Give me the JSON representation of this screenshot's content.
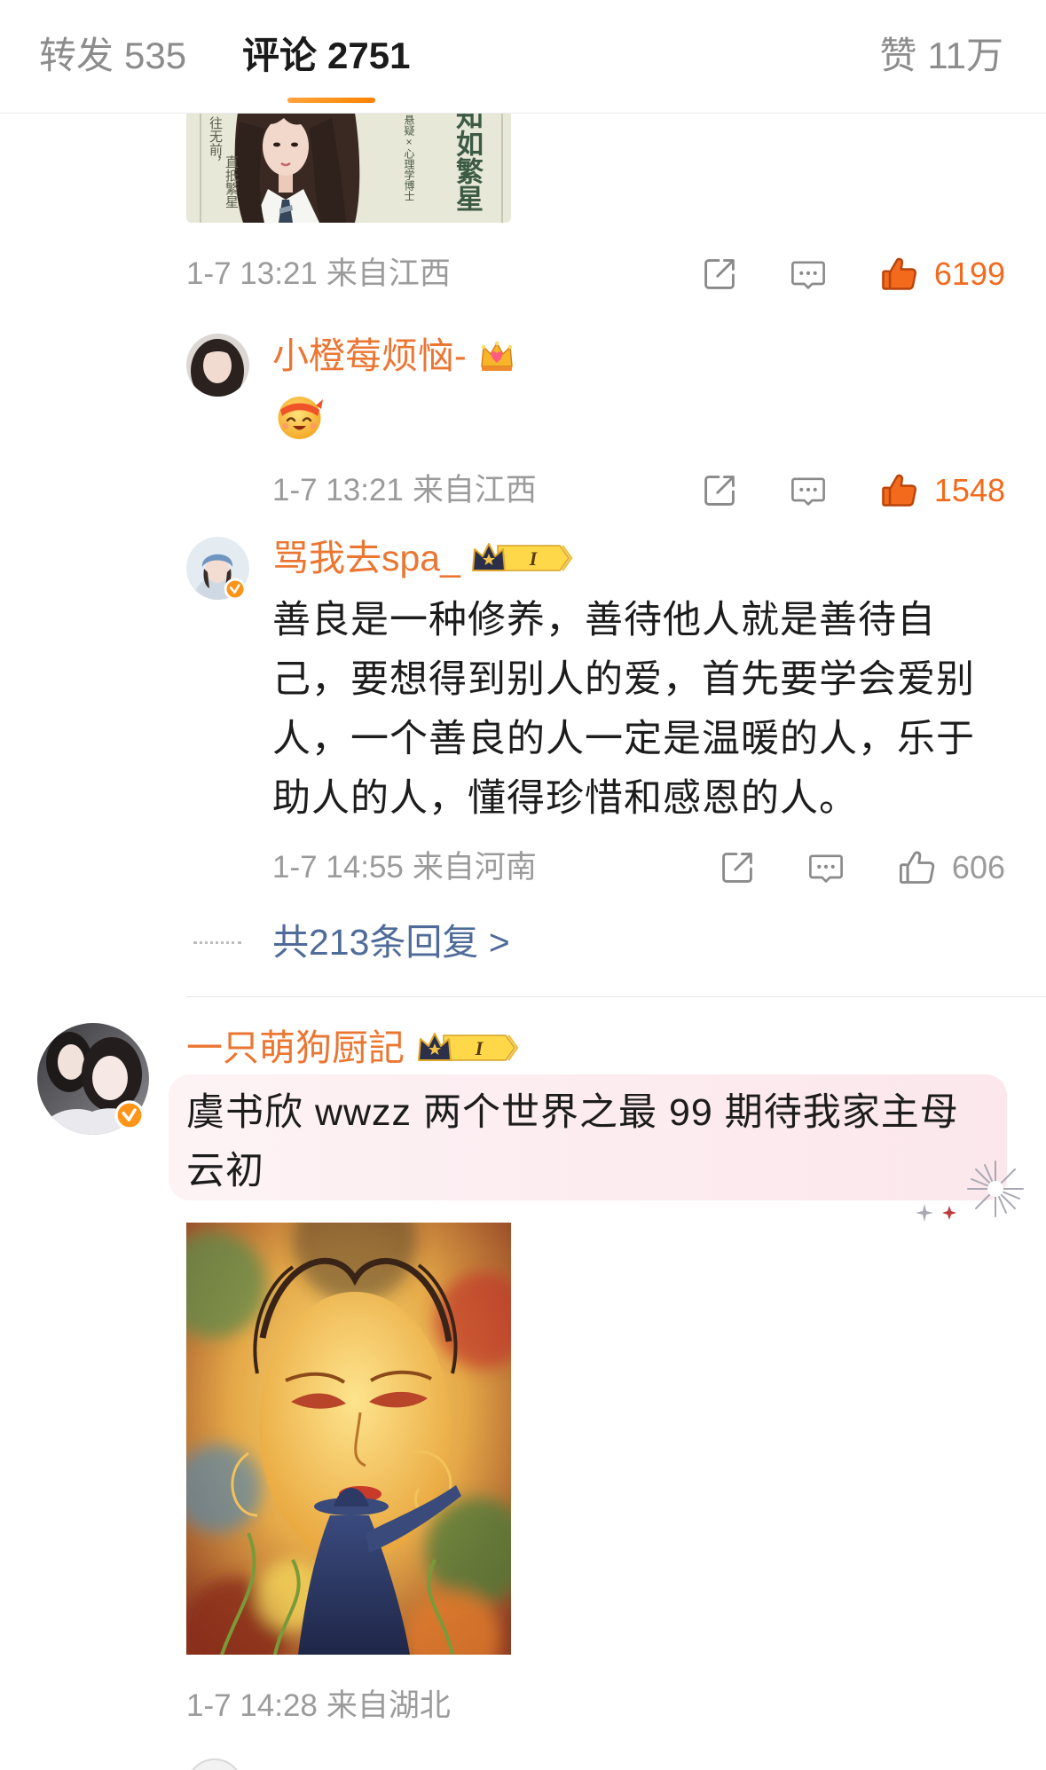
{
  "header": {
    "tabs": [
      {
        "label": "转发",
        "count": "535"
      },
      {
        "label": "评论",
        "count": "2751"
      }
    ],
    "active_tab": "评论",
    "likes": {
      "label": "赞",
      "count": "11万"
    }
  },
  "colors": {
    "accent": "#ff8200",
    "username": "#eb7632",
    "liked": "#f36a1c",
    "meta": "#9b9b9b",
    "reply_link": "#4f6b99"
  },
  "top_post": {
    "image": {
      "icon": "book-cover-image",
      "title": "知如繁星",
      "tagline_1": "往无前，",
      "tagline_2": "直抵繁星",
      "genre": "悬疑×心理学博士"
    },
    "meta": {
      "time": "1-7 13:21",
      "location": "来自江西",
      "likes": "6199",
      "liked": true
    }
  },
  "replies": [
    {
      "username": "小橙莓烦恼-",
      "badge_icon": "crown-heart-badge",
      "content_icon": "grinning-headband-emoji",
      "meta": {
        "time": "1-7 13:21",
        "location": "来自江西",
        "likes": "1548",
        "liked": true
      }
    },
    {
      "username": "骂我去spa_",
      "verified": true,
      "badge_icon": "crown-level-badge",
      "badge_level": "I",
      "lines": [
        "善良是一种修养，善待他人就是善待自",
        "己，要想得到别人的爱，首先要学会爱别",
        "人，一个善良的人一定是温暖的人，乐于",
        "助人的人，懂得珍惜和感恩的人。"
      ],
      "meta": {
        "time": "1-7 14:55",
        "location": "来自河南",
        "likes": "606",
        "liked": false
      }
    }
  ],
  "more_replies": "共213条回复 >",
  "comment": {
    "username": "一只萌狗厨記",
    "verified": true,
    "badge_icon": "crown-level-badge",
    "badge_level": "I",
    "lines": [
      "虞书欣 wwzz 两个世界之最 99 期待我家主母",
      "云初"
    ],
    "image": {
      "icon": "painting-image"
    },
    "meta": {
      "time": "1-7 14:28",
      "location": "来自湖北"
    }
  }
}
